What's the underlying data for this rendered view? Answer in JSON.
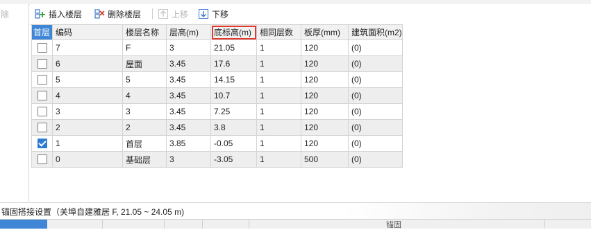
{
  "left_pane": {
    "dim_label": "除"
  },
  "toolbar": {
    "insert_label": "插入楼层",
    "delete_label": "删除楼层",
    "up_label": "上移",
    "down_label": "下移"
  },
  "table": {
    "headers": [
      "首层",
      "编码",
      "楼层名称",
      "层高(m)",
      "底标高(m)",
      "相同层数",
      "板厚(mm)",
      "建筑面积(m2)"
    ],
    "rows": [
      {
        "checked": false,
        "code": "7",
        "name": "F",
        "height": "3",
        "elev": "21.05",
        "same": "1",
        "thick": "120",
        "area": "(0)"
      },
      {
        "checked": false,
        "code": "6",
        "name": "屋面",
        "height": "3.45",
        "elev": "17.6",
        "same": "1",
        "thick": "120",
        "area": "(0)"
      },
      {
        "checked": false,
        "code": "5",
        "name": "5",
        "height": "3.45",
        "elev": "14.15",
        "same": "1",
        "thick": "120",
        "area": "(0)"
      },
      {
        "checked": false,
        "code": "4",
        "name": "4",
        "height": "3.45",
        "elev": "10.7",
        "same": "1",
        "thick": "120",
        "area": "(0)"
      },
      {
        "checked": false,
        "code": "3",
        "name": "3",
        "height": "3.45",
        "elev": "7.25",
        "same": "1",
        "thick": "120",
        "area": "(0)"
      },
      {
        "checked": false,
        "code": "2",
        "name": "2",
        "height": "3.45",
        "elev": "3.8",
        "same": "1",
        "thick": "120",
        "area": "(0)"
      },
      {
        "checked": true,
        "code": "1",
        "name": "首层",
        "height": "3.85",
        "elev": "-0.05",
        "same": "1",
        "thick": "120",
        "area": "(0)"
      },
      {
        "checked": false,
        "code": "0",
        "name": "基础层",
        "height": "3",
        "elev": "-3.05",
        "same": "1",
        "thick": "500",
        "area": "(0)"
      }
    ]
  },
  "status": {
    "text": "锚固搭接设置（关埠自建雅居  F, 21.05 ~ 24.05 m)"
  },
  "bottom": {
    "label": "锚固"
  },
  "colors": {
    "accent": "#3f86d6",
    "highlight_box": "#e03a2e",
    "checkbox_checked": "#2e7bd4"
  }
}
